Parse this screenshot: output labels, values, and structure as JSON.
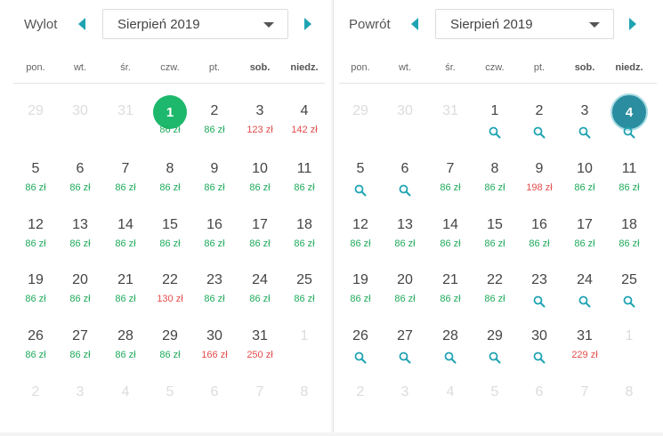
{
  "colors": {
    "accent": "#1fa3b2",
    "price_green": "#1eaa5b",
    "price_red": "#e44b4b",
    "selected_out": "#1db86c",
    "selected_return": "#2a8ea0"
  },
  "icons": {
    "prev": "triangle-left-icon",
    "next": "triangle-right-icon",
    "dropdown": "caret-down-icon",
    "search": "search-icon"
  },
  "outbound": {
    "label": "Wylot",
    "month": "Sierpień 2019",
    "weekdays": [
      "pon.",
      "wt.",
      "śr.",
      "czw.",
      "pt.",
      "sob.",
      "niedz."
    ],
    "weeks": [
      [
        {
          "d": "29",
          "o": 1
        },
        {
          "d": "30",
          "o": 1
        },
        {
          "d": "31",
          "o": 1
        },
        {
          "d": "1",
          "p": "86 zł",
          "sel": 1
        },
        {
          "d": "2",
          "p": "86 zł"
        },
        {
          "d": "3",
          "p": "123 zł",
          "r": 1
        },
        {
          "d": "4",
          "p": "142 zł",
          "r": 1
        }
      ],
      [
        {
          "d": "5",
          "p": "86 zł"
        },
        {
          "d": "6",
          "p": "86 zł"
        },
        {
          "d": "7",
          "p": "86 zł"
        },
        {
          "d": "8",
          "p": "86 zł"
        },
        {
          "d": "9",
          "p": "86 zł"
        },
        {
          "d": "10",
          "p": "86 zł"
        },
        {
          "d": "11",
          "p": "86 zł"
        }
      ],
      [
        {
          "d": "12",
          "p": "86 zł"
        },
        {
          "d": "13",
          "p": "86 zł"
        },
        {
          "d": "14",
          "p": "86 zł"
        },
        {
          "d": "15",
          "p": "86 zł"
        },
        {
          "d": "16",
          "p": "86 zł"
        },
        {
          "d": "17",
          "p": "86 zł"
        },
        {
          "d": "18",
          "p": "86 zł"
        }
      ],
      [
        {
          "d": "19",
          "p": "86 zł"
        },
        {
          "d": "20",
          "p": "86 zł"
        },
        {
          "d": "21",
          "p": "86 zł"
        },
        {
          "d": "22",
          "p": "130 zł",
          "r": 1
        },
        {
          "d": "23",
          "p": "86 zł"
        },
        {
          "d": "24",
          "p": "86 zł"
        },
        {
          "d": "25",
          "p": "86 zł"
        }
      ],
      [
        {
          "d": "26",
          "p": "86 zł"
        },
        {
          "d": "27",
          "p": "86 zł"
        },
        {
          "d": "28",
          "p": "86 zł"
        },
        {
          "d": "29",
          "p": "86 zł"
        },
        {
          "d": "30",
          "p": "166 zł",
          "r": 1
        },
        {
          "d": "31",
          "p": "250 zł",
          "r": 1
        },
        {
          "d": "1",
          "o": 1
        }
      ],
      [
        {
          "d": "2",
          "o": 1
        },
        {
          "d": "3",
          "o": 1
        },
        {
          "d": "4",
          "o": 1
        },
        {
          "d": "5",
          "o": 1
        },
        {
          "d": "6",
          "o": 1
        },
        {
          "d": "7",
          "o": 1
        },
        {
          "d": "8",
          "o": 1
        }
      ]
    ]
  },
  "return": {
    "label": "Powrót",
    "month": "Sierpień 2019",
    "weekdays": [
      "pon.",
      "wt.",
      "śr.",
      "czw.",
      "pt.",
      "sob.",
      "niedz."
    ],
    "weeks": [
      [
        {
          "d": "29",
          "o": 1
        },
        {
          "d": "30",
          "o": 1
        },
        {
          "d": "31",
          "o": 1
        },
        {
          "d": "1",
          "s": 1
        },
        {
          "d": "2",
          "s": 1
        },
        {
          "d": "3",
          "s": 1
        },
        {
          "d": "4",
          "s": 1,
          "sel": 1
        }
      ],
      [
        {
          "d": "5",
          "s": 1
        },
        {
          "d": "6",
          "s": 1
        },
        {
          "d": "7",
          "p": "86 zł"
        },
        {
          "d": "8",
          "p": "86 zł"
        },
        {
          "d": "9",
          "p": "198 zł",
          "r": 1
        },
        {
          "d": "10",
          "p": "86 zł"
        },
        {
          "d": "11",
          "p": "86 zł"
        }
      ],
      [
        {
          "d": "12",
          "p": "86 zł"
        },
        {
          "d": "13",
          "p": "86 zł"
        },
        {
          "d": "14",
          "p": "86 zł"
        },
        {
          "d": "15",
          "p": "86 zł"
        },
        {
          "d": "16",
          "p": "86 zł"
        },
        {
          "d": "17",
          "p": "86 zł"
        },
        {
          "d": "18",
          "p": "86 zł"
        }
      ],
      [
        {
          "d": "19",
          "p": "86 zł"
        },
        {
          "d": "20",
          "p": "86 zł"
        },
        {
          "d": "21",
          "p": "86 zł"
        },
        {
          "d": "22",
          "p": "86 zł"
        },
        {
          "d": "23",
          "s": 1
        },
        {
          "d": "24",
          "s": 1
        },
        {
          "d": "25",
          "s": 1
        }
      ],
      [
        {
          "d": "26",
          "s": 1
        },
        {
          "d": "27",
          "s": 1
        },
        {
          "d": "28",
          "s": 1
        },
        {
          "d": "29",
          "s": 1
        },
        {
          "d": "30",
          "s": 1
        },
        {
          "d": "31",
          "p": "229 zł",
          "r": 1
        },
        {
          "d": "1",
          "o": 1
        }
      ],
      [
        {
          "d": "2",
          "o": 1
        },
        {
          "d": "3",
          "o": 1
        },
        {
          "d": "4",
          "o": 1
        },
        {
          "d": "5",
          "o": 1
        },
        {
          "d": "6",
          "o": 1
        },
        {
          "d": "7",
          "o": 1
        },
        {
          "d": "8",
          "o": 1
        }
      ]
    ]
  }
}
